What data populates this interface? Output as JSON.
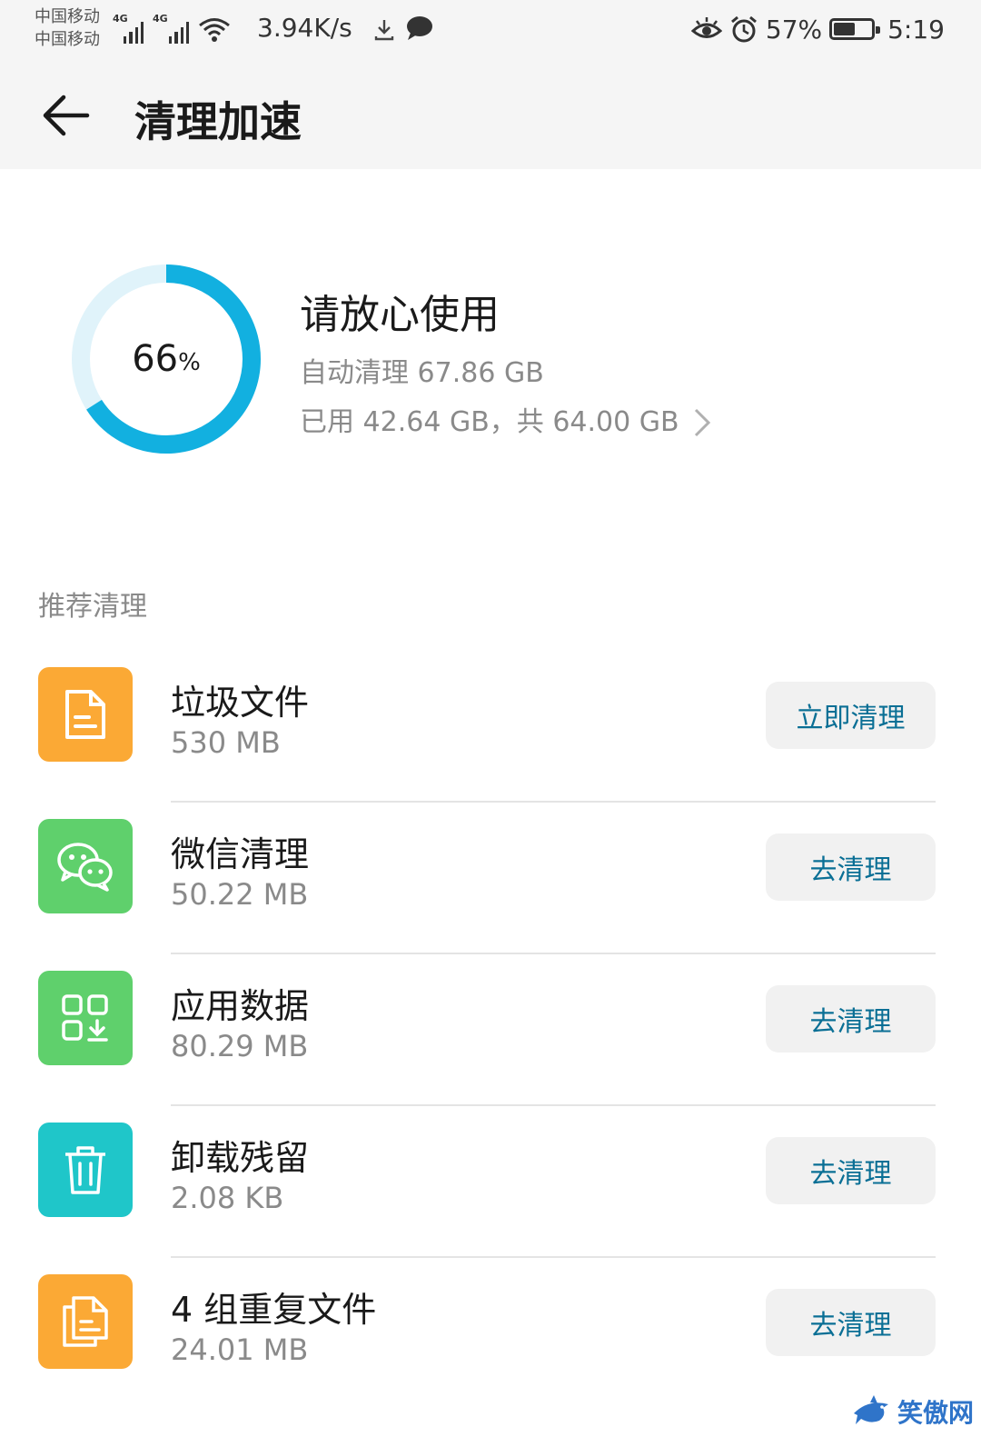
{
  "status_bar": {
    "carrier_1": "中国移动",
    "carrier_2": "中国移动",
    "net_type_1": "4G",
    "net_type_2": "4G",
    "net_speed": "3.94K/s",
    "battery_percent": "57%",
    "battery_level": 0.57,
    "time": "5:19",
    "icons": [
      "signal-icon",
      "wifi-icon",
      "download-icon",
      "message-icon",
      "eye-comfort-icon",
      "alarm-icon",
      "battery-icon"
    ]
  },
  "title_bar": {
    "title": "清理加速"
  },
  "summary": {
    "percent_value": "66",
    "percent_unit": "%",
    "percent_fraction": 0.66,
    "title": "请放心使用",
    "auto_clean": "自动清理 67.86 GB",
    "storage": "已用 42.64 GB，共 64.00 GB",
    "ring_color": "#12b0e0",
    "ring_track_color": "#e0f3fa"
  },
  "section_header": "推荐清理",
  "items": [
    {
      "name": "垃圾文件",
      "size": "530 MB",
      "button": "立即清理",
      "icon": "document-icon",
      "color": "#fba935"
    },
    {
      "name": "微信清理",
      "size": "50.22 MB",
      "button": "去清理",
      "icon": "wechat-icon",
      "color": "#5fd06c"
    },
    {
      "name": "应用数据",
      "size": "80.29 MB",
      "button": "去清理",
      "icon": "app-data-icon",
      "color": "#5fd06c"
    },
    {
      "name": "卸载残留",
      "size": "2.08 KB",
      "button": "去清理",
      "icon": "trash-icon",
      "color": "#1fc6c9"
    },
    {
      "name": "4 组重复文件",
      "size": "24.01 MB",
      "button": "去清理",
      "icon": "duplicate-files-icon",
      "color": "#fba935"
    }
  ],
  "watermark": "笑傲网"
}
